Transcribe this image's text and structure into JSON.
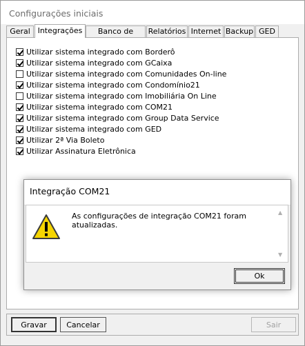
{
  "window": {
    "title": "Configurações iniciais"
  },
  "tabs": [
    "Geral",
    "Integrações",
    "Banco de Dados",
    "Relatórios",
    "Internet",
    "Backup",
    "GED"
  ],
  "active_tab": "Integrações",
  "options": [
    {
      "label": "Utilizar sistema integrado com Borderô",
      "checked": true
    },
    {
      "label": "Utilizar sistema integrado com GCaixa",
      "checked": true
    },
    {
      "label": "Utilizar sistema integrado com Comunidades On-line",
      "checked": false
    },
    {
      "label": "Utilizar sistema integrado com Condomínio21",
      "checked": true
    },
    {
      "label": "Utilizar sistema integrado com Imobiliária On Line",
      "checked": false
    },
    {
      "label": "Utilizar sistema integrado com COM21",
      "checked": true
    },
    {
      "label": "Utilizar sistema integrado com Group Data Service",
      "checked": true
    },
    {
      "label": "Utilizar sistema integrado com GED",
      "checked": true
    },
    {
      "label": "Utilizar 2ª Via Boleto",
      "checked": true
    },
    {
      "label": "Utilizar Assinatura Eletrônica",
      "checked": true
    }
  ],
  "dialog": {
    "title": "Integração COM21",
    "message": "As configurações de integração COM21 foram atualizadas.",
    "ok_label": "Ok",
    "icon": "warning-icon"
  },
  "footer": {
    "save_label": "Gravar",
    "cancel_label": "Cancelar",
    "exit_label": "Sair"
  }
}
